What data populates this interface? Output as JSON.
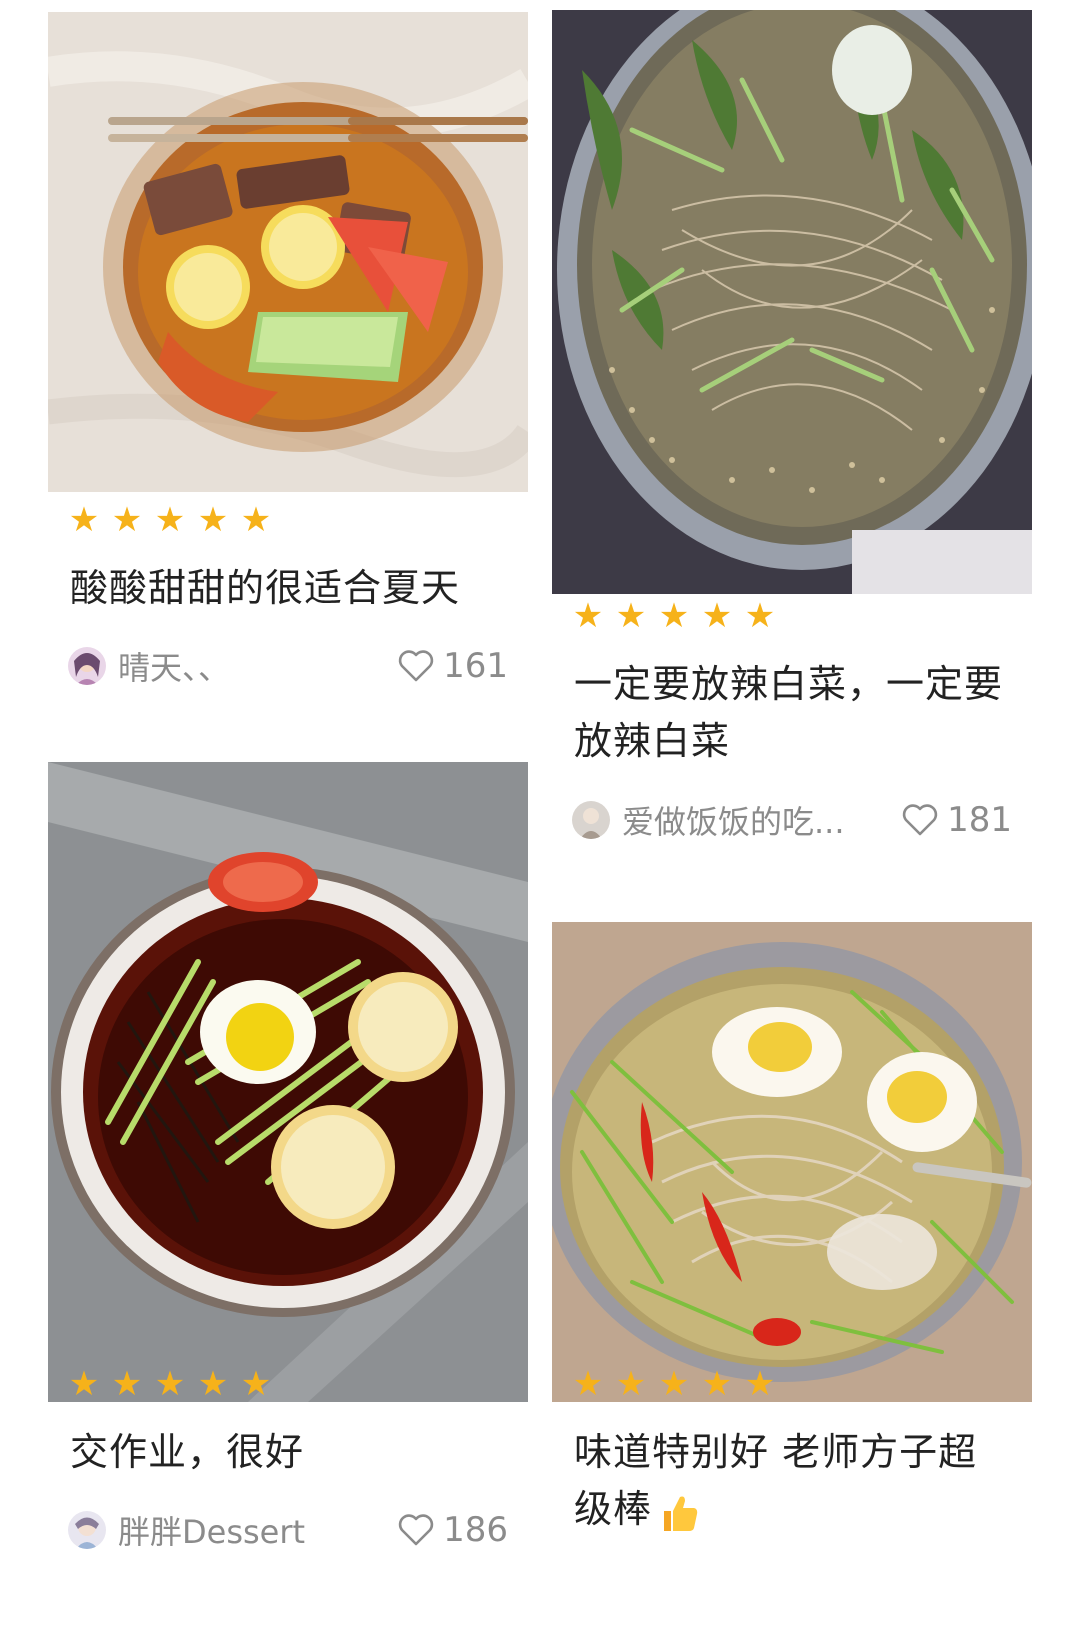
{
  "feed": {
    "cards": [
      {
        "title": "酸酸甜甜的很适合夏天",
        "author": "晴天、、",
        "likes": "161",
        "rating": 5,
        "image": "cold-noodles-glass-bowl-watermelon-lemon"
      },
      {
        "title": "一定要放辣白菜，一定要放辣白菜",
        "author": "爱做饭饭的吃...",
        "likes": "181",
        "rating": 5,
        "image": "cold-noodles-steel-bowl-cucumber-sesame"
      },
      {
        "title": "交作业，很好",
        "author": "胖胖Dessert",
        "likes": "186",
        "rating": 5,
        "image": "cold-noodles-ceramic-bowl-egg-lemon"
      },
      {
        "title": "味道特别好 老师方子超级棒",
        "title_emoji": "thumbs-up-icon",
        "author": "",
        "likes": "",
        "rating": 5,
        "image": "cold-noodles-steel-bowl-eggs-chili"
      }
    ]
  },
  "colors": {
    "star": "#f6b21a",
    "text": "#222222",
    "muted": "#8b8b8b"
  }
}
